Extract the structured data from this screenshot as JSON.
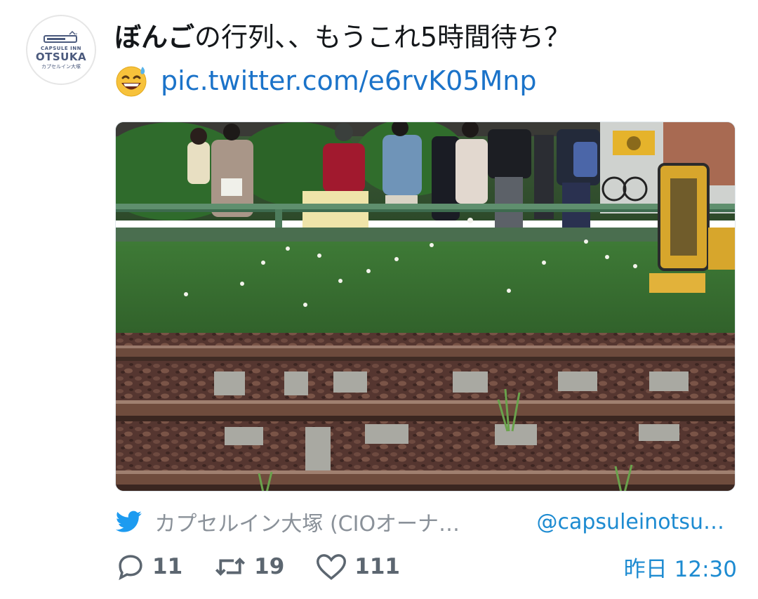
{
  "avatar": {
    "line1": "CAPSULE INN",
    "line2": "OTSUKA",
    "line3": "カプセルイン大塚"
  },
  "tweet": {
    "bold_text": "ぼんご",
    "text": "の行列、、もうこれ5時間待ち？",
    "emoji": "grinning-sweat-emoji",
    "link": "pic.twitter.com/e6rvK05Mnp"
  },
  "source": {
    "icon": "twitter-bird-icon",
    "author": "カプセルイン大塚 (CIOオーナ…",
    "handle": "@capsuleinotsu…"
  },
  "actions": {
    "replies": "11",
    "retweets": "19",
    "likes": "111",
    "time": "昨日 12:30"
  },
  "colors": {
    "link": "#1b73c9",
    "accent": "#1d8bd1",
    "muted": "#5c6670"
  }
}
